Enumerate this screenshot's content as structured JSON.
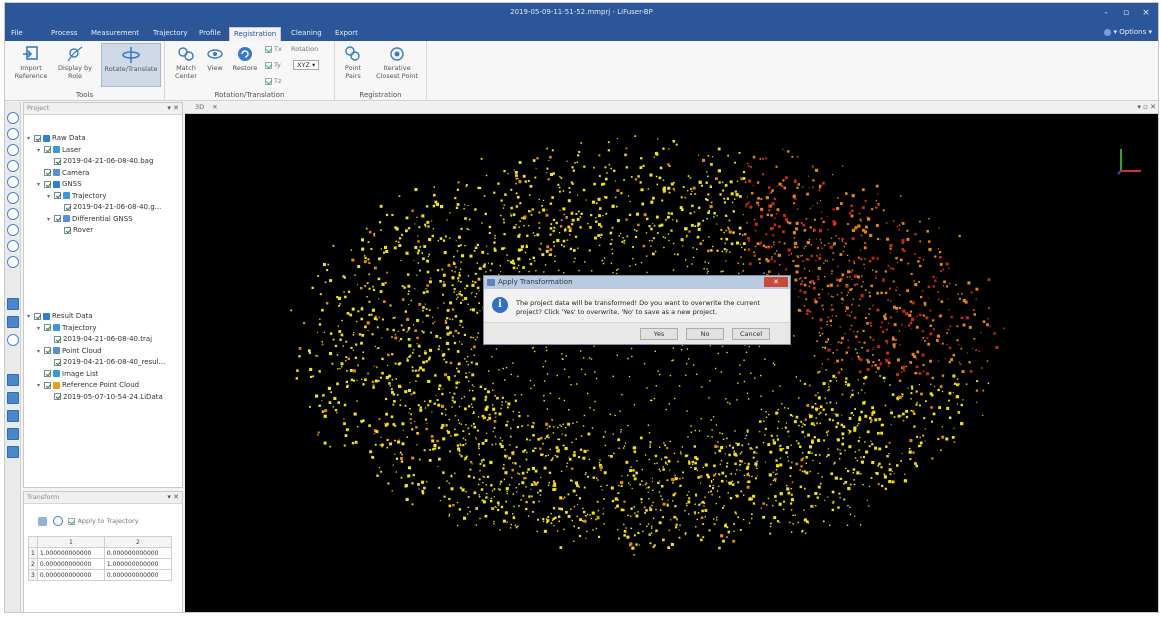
{
  "window": {
    "title": "2019-05-09-11-51-52.mmprj - LiFuser-BP",
    "controls": [
      "-",
      "▫",
      "×"
    ]
  },
  "menu": {
    "tabs": [
      "File",
      "Process",
      "Measurement",
      "Trajectory",
      "Profile",
      "Registration",
      "Cleaning",
      "Export"
    ],
    "active": "Registration",
    "options": "Options"
  },
  "ribbon": {
    "groups": {
      "tools": "Tools",
      "rotation": "Rotation/Translation",
      "registration": "Registration"
    },
    "buttons": {
      "import_reference": "Import Reference",
      "display_by_role": "Display by Role",
      "rotate_translate": "Rotate/Translate",
      "match_center": "Match Center",
      "view": "View",
      "restore": "Restore",
      "point_pairs": "Point Pairs",
      "icp": "Iterative Closest Point"
    },
    "checks": {
      "tx": "Tx",
      "ty": "Ty",
      "tz": "Tz",
      "rotation": "Rotation"
    },
    "rotation_order": "XYZ"
  },
  "project_panel": {
    "title": "Project",
    "raw_tree": [
      {
        "label": "Raw Data",
        "depth": 0
      },
      {
        "label": "Laser",
        "depth": 1
      },
      {
        "label": "2019-04-21-06-08-40.bag",
        "depth": 2
      },
      {
        "label": "Camera",
        "depth": 1
      },
      {
        "label": "GNSS",
        "depth": 1
      },
      {
        "label": "Trajectory",
        "depth": 2
      },
      {
        "label": "2019-04-21-06-08-40.g...",
        "depth": 3
      },
      {
        "label": "Differential GNSS",
        "depth": 2
      },
      {
        "label": "Rover",
        "depth": 3
      }
    ],
    "result_tree": [
      {
        "label": "Result Data",
        "depth": 0
      },
      {
        "label": "Trajectory",
        "depth": 1
      },
      {
        "label": "2019-04-21-06-08-40.traj",
        "depth": 2
      },
      {
        "label": "Point Cloud",
        "depth": 1
      },
      {
        "label": "2019-04-21-06-08-40_resul...",
        "depth": 2
      },
      {
        "label": "Image List",
        "depth": 1
      },
      {
        "label": "Reference Point Cloud",
        "depth": 1
      },
      {
        "label": "2019-05-07-10-54-24.LiData",
        "depth": 2
      }
    ]
  },
  "transform_panel": {
    "title": "Transform",
    "apply_label": "Apply to Trajectory",
    "columns": [
      "1",
      "2"
    ],
    "rows": [
      {
        "index": "1",
        "c1": "1.000000000000",
        "c2": "0.000000000000"
      },
      {
        "index": "2",
        "c1": "0.000000000000",
        "c2": "1.000000000000"
      },
      {
        "index": "3",
        "c1": "0.000000000000",
        "c2": "0.000000000000"
      }
    ]
  },
  "viewport": {
    "tab_label": "3D"
  },
  "dialog": {
    "title": "Apply Transformation",
    "message": "The project data will be transformed! Do you want to overwrite the current project? Click 'Yes' to overwrite, 'No' to save as a new project.",
    "yes": "Yes",
    "no": "No",
    "cancel": "Cancel"
  },
  "colors": {
    "titlebar": "#2b579a",
    "point_yellow": "#f2e21a",
    "point_orange": "#e8850f",
    "point_red": "#c8281a"
  }
}
